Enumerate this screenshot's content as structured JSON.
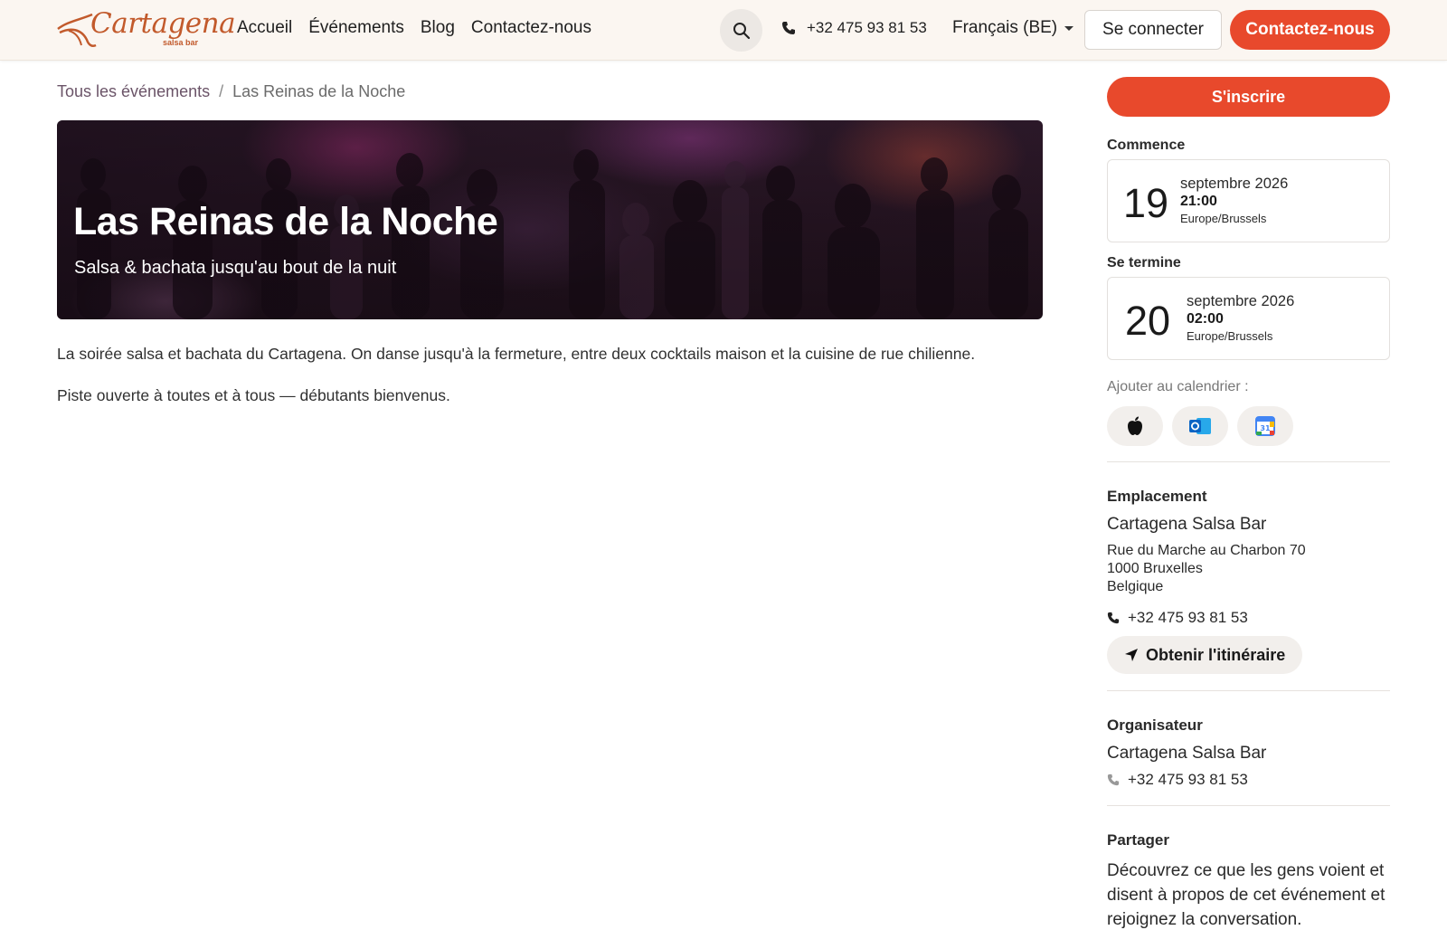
{
  "brand": {
    "name": "Cartagena",
    "tagline": "salsa bar",
    "color": "#c25a2c"
  },
  "nav": {
    "items": [
      "Accueil",
      "Événements",
      "Blog",
      "Contactez-nous"
    ]
  },
  "header": {
    "search_icon": "search-icon",
    "phone": "+32 475 93 81 53",
    "language": "Français (BE)",
    "login_label": "Se connecter",
    "contact_label": "Contactez-nous",
    "accent_color": "#e8492c"
  },
  "breadcrumb": {
    "parent": "Tous les événements",
    "separator": "/",
    "current": "Las Reinas de la Noche"
  },
  "hero": {
    "title": "Las Reinas de la Noche",
    "subtitle": "Salsa & bachata jusqu'au bout de la nuit"
  },
  "description": [
    "La soirée salsa et bachata du Cartagena. On danse jusqu'à la fermeture, entre deux cocktails maison et la cuisine de rue chilienne.",
    "Piste ouverte à toutes et à tous — débutants bienvenus."
  ],
  "sidebar": {
    "signup_label": "S'inscrire",
    "start": {
      "label": "Commence",
      "day": "19",
      "month_year": "septembre 2026",
      "time": "21:00",
      "timezone": "Europe/Brussels"
    },
    "end": {
      "label": "Se termine",
      "day": "20",
      "month_year": "septembre 2026",
      "time": "02:00",
      "timezone": "Europe/Brussels"
    },
    "calendar": {
      "label": "Ajouter au calendrier :",
      "icons": [
        "apple-icon",
        "outlook-icon",
        "google-calendar-icon"
      ]
    },
    "location": {
      "heading": "Emplacement",
      "name": "Cartagena Salsa Bar",
      "street": "Rue du Marche au Charbon 70",
      "city": "1000 Bruxelles",
      "country": "Belgique",
      "phone": "+32 475 93 81 53",
      "route_label": "Obtenir l'itinéraire"
    },
    "organizer": {
      "heading": "Organisateur",
      "name": "Cartagena Salsa Bar",
      "phone": "+32 475 93 81 53"
    },
    "share": {
      "heading": "Partager",
      "text": "Découvrez ce que les gens voient et disent à propos de cet événement et rejoignez la conversation."
    }
  }
}
